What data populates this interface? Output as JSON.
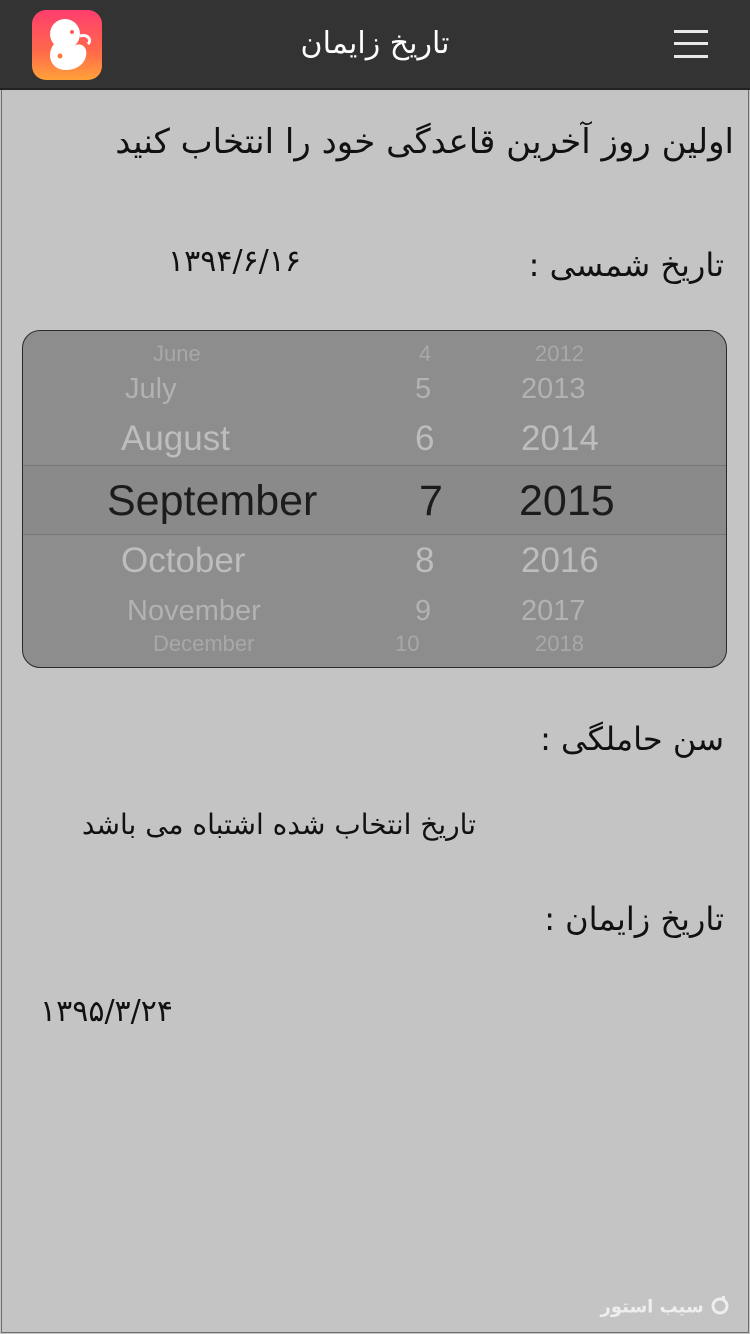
{
  "header": {
    "title": "تاریخ زایمان"
  },
  "instruction": "اولین روز آخرین قاعدگی خود را انتخاب کنید",
  "solar_date": {
    "label": "تاریخ شمسی :",
    "value": "۱۳۹۴/۶/۱۶"
  },
  "picker": {
    "months": [
      "June",
      "July",
      "August",
      "September",
      "October",
      "November",
      "December"
    ],
    "days": [
      "4",
      "5",
      "6",
      "7",
      "8",
      "9",
      "10"
    ],
    "years": [
      "2012",
      "2013",
      "2014",
      "2015",
      "2016",
      "2017",
      "2018"
    ],
    "selected": {
      "month": "September",
      "day": "7",
      "year": "2015"
    }
  },
  "gestational_age": {
    "label": "سن حاملگی :",
    "value": "تاریخ انتخاب شده اشتباه می باشد"
  },
  "due_date": {
    "label": "تاریخ زایمان :",
    "value": "۱۳۹۵/۳/۲۴"
  },
  "watermark": "سیب استور",
  "colors": {
    "header_bg": "#333333",
    "page_bg": "#c4c4c4",
    "picker_bg": "#8d8d8d",
    "icon_gradient": [
      "#ff3d6e",
      "#ffa23a"
    ]
  }
}
